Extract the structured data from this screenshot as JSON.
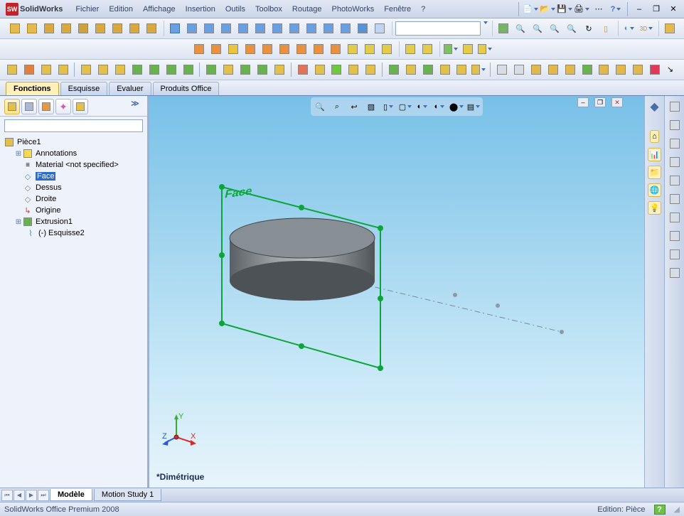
{
  "app": {
    "name": "SolidWorks"
  },
  "menu": [
    "Fichier",
    "Edition",
    "Affichage",
    "Insertion",
    "Outils",
    "Toolbox",
    "Routage",
    "PhotoWorks",
    "Fenêtre",
    "?"
  ],
  "tabs": {
    "items": [
      "Fonctions",
      "Esquisse",
      "Evaluer",
      "Produits Office"
    ],
    "active": 0
  },
  "tree": {
    "root": "Pièce1",
    "items": [
      {
        "label": "Annotations",
        "expandable": true
      },
      {
        "label": "Material <not specified>"
      },
      {
        "label": "Face",
        "selected": true
      },
      {
        "label": "Dessus"
      },
      {
        "label": "Droite"
      },
      {
        "label": "Origine"
      },
      {
        "label": "Extrusion1",
        "expandable": true
      },
      {
        "label": "(-) Esquisse2",
        "indent": 2
      }
    ]
  },
  "viewport": {
    "plane_label": "Face",
    "projection_label": "*Dimétrique",
    "axis": {
      "x": "X",
      "y": "Y",
      "z": "Z"
    }
  },
  "bottom_tabs": {
    "items": [
      "Modèle",
      "Motion Study 1"
    ],
    "active": 0
  },
  "status": {
    "left": "SolidWorks Office Premium 2008",
    "edition": "Edition: Pièce",
    "help": "?"
  },
  "icons": {
    "new": "D",
    "open": "📂",
    "save": "💾",
    "print": "🖨",
    "help": "?",
    "minimize": "–",
    "restore": "❐",
    "close": "✕",
    "home": "⌂",
    "chart": "📊",
    "folder": "📁",
    "web": "🌐",
    "bulb": "💡",
    "zoomfit": "🔍",
    "zoomwin": "⌕",
    "rotate": "↻",
    "section": "▧",
    "display": "▢",
    "scene": "◐",
    "shadow": "●",
    "expand_arrows": "≫"
  },
  "colors": {
    "plane_green": "#0aa638",
    "axis_x": "#d92a2a",
    "axis_y": "#33b02c",
    "axis_z": "#2a5adf"
  }
}
